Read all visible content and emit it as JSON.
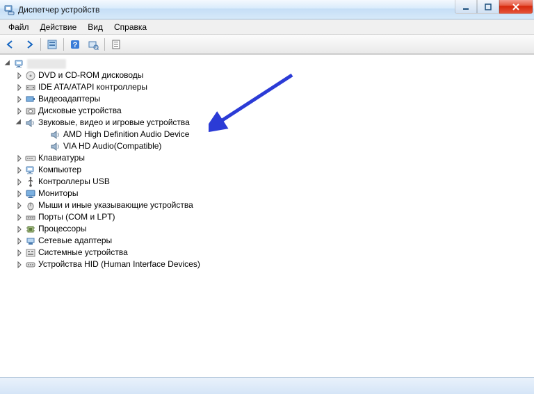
{
  "window": {
    "title": "Диспетчер устройств"
  },
  "menus": {
    "file": "Файл",
    "action": "Действие",
    "view": "Вид",
    "help": "Справка"
  },
  "tree": {
    "root": {
      "obscured": true
    },
    "items": [
      {
        "label": "DVD и CD-ROM дисководы",
        "icon": "optical-drive"
      },
      {
        "label": "IDE ATA/ATAPI контроллеры",
        "icon": "ide-controller"
      },
      {
        "label": "Видеоадаптеры",
        "icon": "display-adapter"
      },
      {
        "label": "Дисковые устройства",
        "icon": "disk-drive"
      },
      {
        "label": "Звуковые, видео и игровые устройства",
        "icon": "sound",
        "expanded": true,
        "children": [
          {
            "label": "AMD High Definition Audio Device",
            "icon": "sound"
          },
          {
            "label": "VIA HD Audio(Compatible)",
            "icon": "sound"
          }
        ]
      },
      {
        "label": "Клавиатуры",
        "icon": "keyboard"
      },
      {
        "label": "Компьютер",
        "icon": "computer"
      },
      {
        "label": "Контроллеры USB",
        "icon": "usb"
      },
      {
        "label": "Мониторы",
        "icon": "monitor"
      },
      {
        "label": "Мыши и иные указывающие устройства",
        "icon": "mouse"
      },
      {
        "label": "Порты (COM и LPT)",
        "icon": "port"
      },
      {
        "label": "Процессоры",
        "icon": "cpu"
      },
      {
        "label": "Сетевые адаптеры",
        "icon": "network"
      },
      {
        "label": "Системные устройства",
        "icon": "system"
      },
      {
        "label": "Устройства HID (Human Interface Devices)",
        "icon": "hid"
      }
    ]
  }
}
